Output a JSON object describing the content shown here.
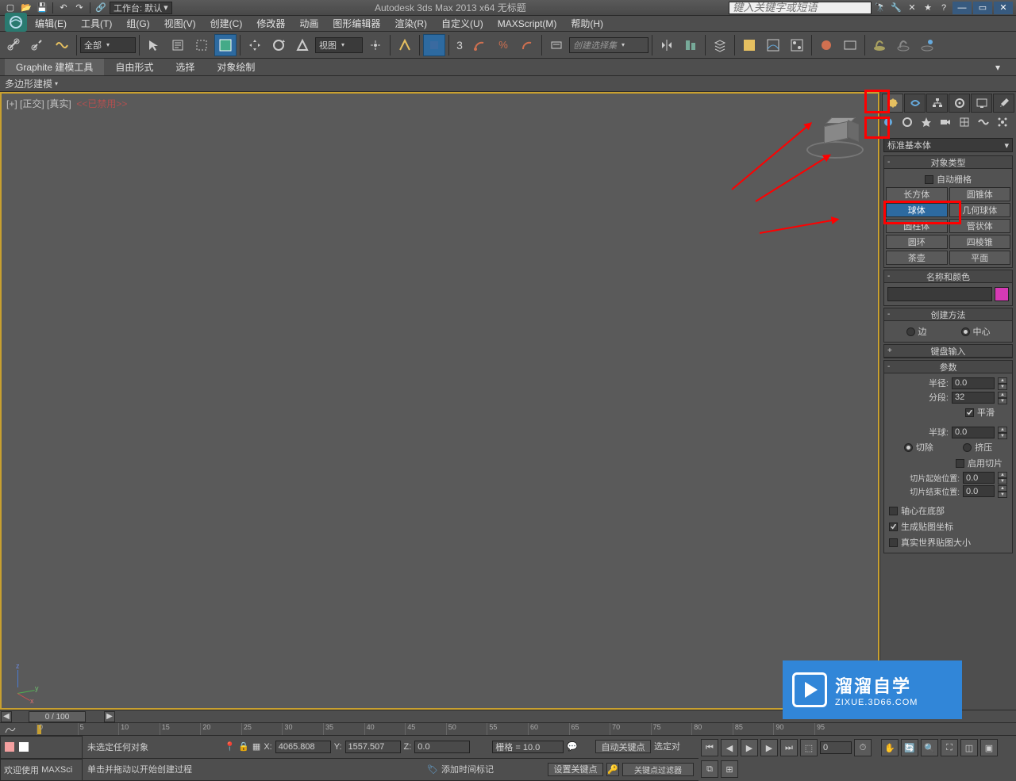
{
  "title": "Autodesk 3ds Max  2013 x64     无标题",
  "search_placeholder": "键入关键字或短语",
  "qabar": {
    "workspace_label": "工作台: 默认"
  },
  "menus": [
    "编辑(E)",
    "工具(T)",
    "组(G)",
    "视图(V)",
    "创建(C)",
    "修改器",
    "动画",
    "图形编辑器",
    "渲染(R)",
    "自定义(U)",
    "MAXScript(M)",
    "帮助(H)"
  ],
  "toolbar": {
    "filter_combo": "全部",
    "view_combo": "视图",
    "selset_combo": "创建选择集",
    "three": "3"
  },
  "ribbon": {
    "tabs": [
      "Graphite 建模工具",
      "自由形式",
      "选择",
      "对象绘制"
    ],
    "sub": "多边形建模"
  },
  "viewport": {
    "label": "[+] [正交] [真实]",
    "disabled": "<<已禁用>>",
    "axes": {
      "x": "x",
      "y": "y",
      "z": "z"
    }
  },
  "trackbar": {
    "pos": "0 / 100"
  },
  "timeruler": {
    "ticks": [
      0,
      5,
      10,
      15,
      20,
      25,
      30,
      35,
      40,
      45,
      50,
      55,
      60,
      65,
      70,
      75,
      80,
      85,
      90,
      95
    ]
  },
  "cmdpanel": {
    "dropdown": "标准基本体",
    "rollouts": {
      "obj_type_hdr": "对象类型",
      "autogrid": "自动栅格",
      "objects": [
        "长方体",
        "圆锥体",
        "球体",
        "几何球体",
        "圆柱体",
        "管状体",
        "圆环",
        "四棱锥",
        "茶壶",
        "平面"
      ],
      "name_hdr": "名称和颜色",
      "method_hdr": "创建方法",
      "method_edge": "边",
      "method_center": "中心",
      "kb_hdr": "键盘输入",
      "params_hdr": "参数",
      "radius_lbl": "半径:",
      "radius_val": "0.0",
      "segs_lbl": "分段:",
      "segs_val": "32",
      "smooth": "平滑",
      "hemi_lbl": "半球:",
      "hemi_val": "0.0",
      "chop": "切除",
      "squash": "挤压",
      "slice_on": "启用切片",
      "slice_from_lbl": "切片起始位置:",
      "slice_from_val": "0.0",
      "slice_to_lbl": "切片结束位置:",
      "slice_to_val": "0.0",
      "base_pivot": "轴心在底部",
      "gen_uv": "生成贴图坐标",
      "real_world": "真实世界贴图大小"
    }
  },
  "status": {
    "sel_text": "未选定任何对象",
    "prompt": "单击并拖动以开始创建过程",
    "x_lbl": "X:",
    "x_val": "4065.808",
    "y_lbl": "Y:",
    "y_val": "1557.507",
    "z_lbl": "Z:",
    "z_val": "0.0",
    "grid": "栅格 = 10.0",
    "add_time": "添加时间标记",
    "welcome1": "欢迎使用",
    "welcome2": "MAXSci",
    "autokey": "自动关键点",
    "setkey": "设置关键点",
    "sel_combo": "选定对",
    "keyfilter": "关键点过滤器"
  },
  "watermark": {
    "cn": "溜溜自学",
    "en": "ZIXUE.3D66.COM"
  }
}
